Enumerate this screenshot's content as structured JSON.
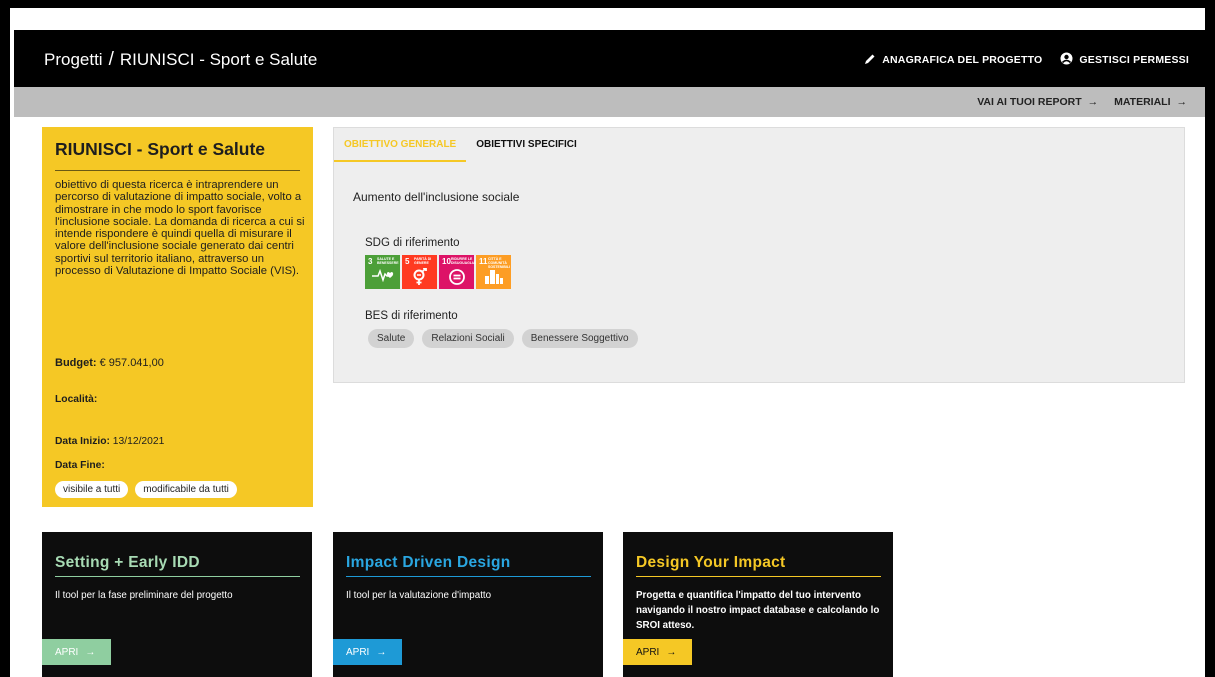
{
  "header": {
    "breadcrumb_root": "Progetti",
    "breadcrumb_sep": "/",
    "breadcrumb_current": "RIUNISCI - Sport e Salute",
    "actions": [
      {
        "label": "ANAGRAFICA DEL PROGETTO",
        "icon": "pencil-icon"
      },
      {
        "label": "GESTISCI PERMESSI",
        "icon": "user-permissions-icon"
      }
    ]
  },
  "subbar": {
    "links": [
      {
        "label": "VAI AI TUOI REPORT",
        "icon": "arrow-right-icon"
      },
      {
        "label": "MATERIALI",
        "icon": "arrow-right-icon"
      }
    ]
  },
  "project": {
    "title": "RIUNISCI - Sport e Salute",
    "description": "obiettivo di questa ricerca è intraprendere un percorso di valutazione di impatto sociale, volto a dimostrare in che modo lo sport favorisce l'inclusione sociale. La domanda di ricerca a cui si intende rispondere è quindi quella di misurare il valore dell'inclusione sociale generato dai centri sportivi sul territorio italiano, attraverso un processo di Valutazione di Impatto Sociale (VIS).",
    "budget_label": "Budget:",
    "budget_value": "€ 957.041,00",
    "location_label": "Località:",
    "location_value": "",
    "start_label": "Data Inizio:",
    "start_value": "13/12/2021",
    "end_label": "Data Fine:",
    "end_value": "",
    "chips": [
      "visibile a tutti",
      "modificabile da tutti"
    ]
  },
  "objectives": {
    "tabs": [
      "OBIETTIVO GENERALE",
      "OBIETTIVI SPECIFICI"
    ],
    "active_tab": 0,
    "general_goal": "Aumento dell'inclusione sociale",
    "sdg_label": "SDG di riferimento",
    "sdgs": [
      {
        "number": "3",
        "title": "SALUTE E BENESSERE",
        "color": "#4c9f38",
        "icon": "heartbeat-icon"
      },
      {
        "number": "5",
        "title": "PARITÀ DI GENERE",
        "color": "#ff3a21",
        "icon": "gender-equality-icon"
      },
      {
        "number": "10",
        "title": "RIDURRE LE DISUGUAGLIANZE",
        "color": "#dd1367",
        "icon": "equality-icon"
      },
      {
        "number": "11",
        "title": "CITTÀ E COMUNITÀ SOSTENIBILI",
        "color": "#fd9d24",
        "icon": "city-icon"
      }
    ],
    "bes_label": "BES di riferimento",
    "bes": [
      "Salute",
      "Relazioni Sociali",
      "Benessere Soggettivo"
    ]
  },
  "tools": [
    {
      "title": "Setting + Early IDD",
      "description": "Il tool per la fase preliminare del progetto",
      "button": "APRI",
      "accent": "#8fcea0",
      "title_color": "#a8dbb4"
    },
    {
      "title": "Impact Driven Design",
      "description": "Il tool per la valutazione d'impatto",
      "button": "APRI",
      "accent": "#1e9ad6",
      "title_color": "#2aa6e0"
    },
    {
      "title": "Design Your Impact",
      "description": "Progetta e quantifica l'impatto del tuo intervento navigando il nostro impact database e calcolando lo SROI atteso.",
      "button": "APRI",
      "accent": "#f5c825",
      "title_color": "#f5c825"
    }
  ]
}
